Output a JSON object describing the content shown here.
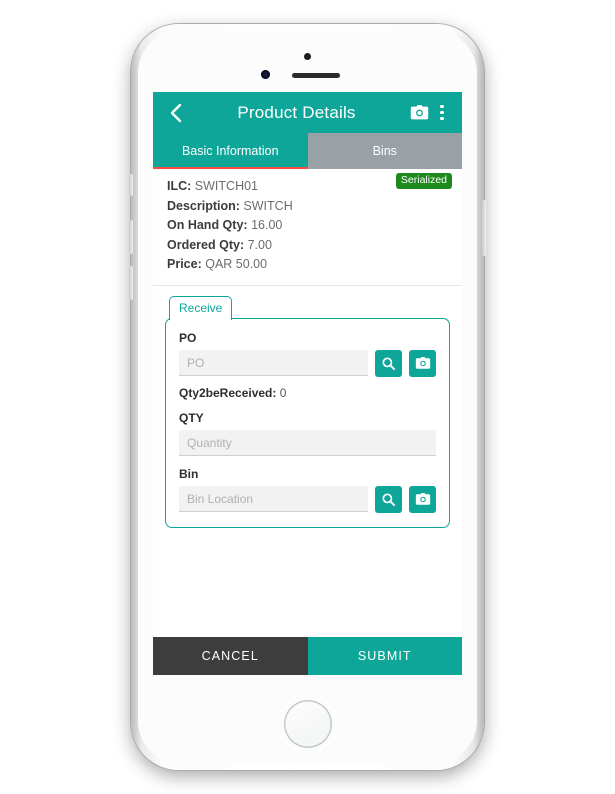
{
  "app_bar": {
    "title": "Product Details",
    "back_icon": "chevron-left-icon",
    "camera_icon": "camera-icon",
    "overflow_icon": "more-vertical-icon"
  },
  "tabs": [
    {
      "label": "Basic Information",
      "active": true
    },
    {
      "label": "Bins",
      "active": false
    }
  ],
  "product": {
    "badge": "Serialized",
    "rows": [
      {
        "key": "ILC",
        "value": "SWITCH01"
      },
      {
        "key": "Description",
        "value": "SWITCH"
      },
      {
        "key": "On Hand Qty",
        "value": "16.00"
      },
      {
        "key": "Ordered Qty",
        "value": "7.00"
      },
      {
        "key": "Price",
        "value": "QAR 50.00"
      }
    ]
  },
  "receive": {
    "tab_label": "Receive",
    "po": {
      "label": "PO",
      "placeholder": "PO",
      "value": "",
      "search_icon": "search-icon",
      "camera_icon": "camera-icon"
    },
    "qty_note": {
      "key": "Qty2beReceived",
      "value": "0"
    },
    "qty": {
      "label": "QTY",
      "placeholder": "Quantity",
      "value": ""
    },
    "bin": {
      "label": "Bin",
      "placeholder": "Bin Location",
      "value": "",
      "search_icon": "search-icon",
      "camera_icon": "camera-icon"
    }
  },
  "actions": {
    "cancel_label": "CANCEL",
    "submit_label": "SUBMIT"
  },
  "colors": {
    "primary_teal": "#0fa69a",
    "tab_inactive_gray": "#99a0a6",
    "badge_green": "#1d8a1d",
    "cancel_dark": "#3d3d3d",
    "active_tab_indicator": "#ff4b3e"
  }
}
